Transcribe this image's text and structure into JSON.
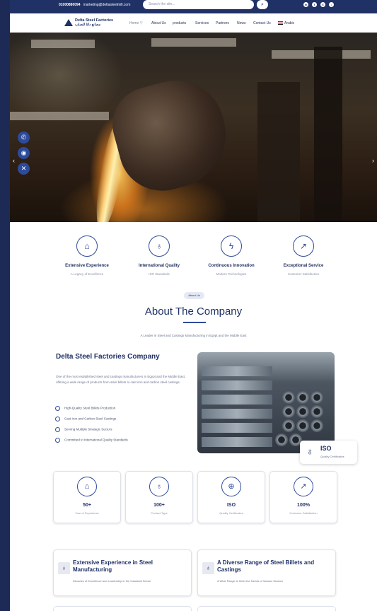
{
  "topbar": {
    "phone": "01000880094",
    "email": "marketing@deltasteelmill.com",
    "search_placeholder": "Search the site...",
    "socials": [
      "linkedin-icon",
      "facebook-icon",
      "x-icon",
      "tiktok-icon"
    ]
  },
  "nav": {
    "logo_en": "Delta Steel Factories",
    "logo_ar": "مصانع دلتا للصلب",
    "items": [
      "Home ▽",
      "About Us",
      "products",
      "Services",
      "Partners",
      "News",
      "Contact Us"
    ],
    "language": "Arabic"
  },
  "features": [
    {
      "icon": "factory-icon",
      "title": "Extensive Experience",
      "sub": "A Legacy of Excellence"
    },
    {
      "icon": "award-icon",
      "title": "International Quality",
      "sub": "ISO Standards"
    },
    {
      "icon": "lightning-icon",
      "title": "Continuous Innovation",
      "sub": "Modern Technologies"
    },
    {
      "icon": "trend-up-icon",
      "title": "Exceptional Service",
      "sub": "Customer Satisfaction"
    }
  ],
  "about": {
    "badge": "About Us",
    "heading": "About The Company",
    "subtitle": "A Leader in Steel and Castings Manufacturing in Egypt and the Middle East",
    "company_title": "Delta Steel Factories Company",
    "description": "One of the most established steel and castings manufacturers in Egypt and the Middle East, offering a wide range of products from steel billets to cast iron and carbon steel castings.",
    "checklist": [
      "High-Quality Steel Billets Production",
      "Cast Iron and Carbon Steel Castings",
      "Serving Multiple Strategic Sectors",
      "Committed to International Quality Standards"
    ],
    "iso_title": "ISO",
    "iso_sub": "Quality Certificates"
  },
  "stats": [
    {
      "icon": "factory-icon",
      "value": "50+",
      "label": "Year of Experience"
    },
    {
      "icon": "award-icon",
      "value": "100+",
      "label": "Product Type"
    },
    {
      "icon": "globe-icon",
      "value": "ISO",
      "label": "Quality Certificates"
    },
    {
      "icon": "trend-up-icon",
      "value": "100%",
      "label": "Customer Satisfaction"
    }
  ],
  "cards": [
    {
      "icon": "award-icon",
      "title": "Extensive Experience in Steel Manufacturing",
      "sub": "Decades of Excellence and Leadership in the Industrial Sector"
    },
    {
      "icon": "award-icon",
      "title": "A Diverse Range of Steel Billets and Castings",
      "sub": "A Wide Range to Meet the Needs of Various Sectors"
    }
  ],
  "colors": {
    "primary": "#1f3165",
    "accent": "#2d4b9a",
    "muted": "#8a93a8"
  }
}
